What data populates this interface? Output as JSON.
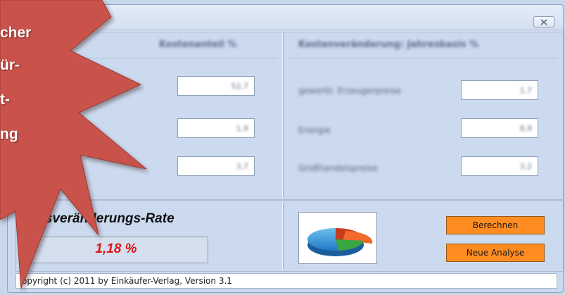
{
  "window": {
    "close_icon": "close-icon"
  },
  "left_panel": {
    "header": "Kostenanteil %",
    "fields": [
      "52,7",
      "1,9",
      "3,7"
    ]
  },
  "right_panel": {
    "header": "Kostenveränderung: Jahresbasis %",
    "rows": [
      {
        "label": "gewerbl. Erzeugerpreise",
        "value": "1,7"
      },
      {
        "label": "Energie",
        "value": "8,9"
      },
      {
        "label": "Großhandelspreise",
        "value": "3,2"
      }
    ]
  },
  "result": {
    "title": "Preisveränderungs-Rate",
    "value": "1,18 %"
  },
  "buttons": {
    "calculate": "Berechnen",
    "new_analysis": "Neue Analyse"
  },
  "status": {
    "text": "opyright (c) 2011 by Einkäufer-Verlag, Version 3.1"
  },
  "starburst": {
    "lines": [
      "cher",
      "ür-",
      "t-",
      "ng"
    ],
    "color": "#c9524b"
  },
  "colors": {
    "accent_button": "#ff8c21",
    "result_value": "#e01616"
  }
}
